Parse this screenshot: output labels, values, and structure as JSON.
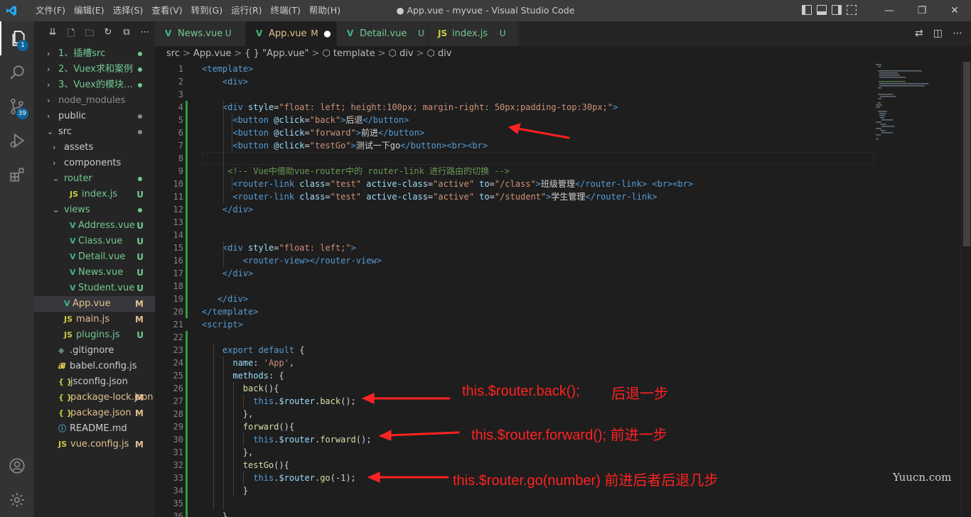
{
  "titlebar": {
    "menu": [
      "文件(F)",
      "编辑(E)",
      "选择(S)",
      "查看(V)",
      "转到(G)",
      "运行(R)",
      "终端(T)",
      "帮助(H)"
    ],
    "title": "● App.vue - myvue - Visual Studio Code",
    "controls": [
      "—",
      "❐",
      "✕"
    ]
  },
  "activity": {
    "explorer_badge": "1",
    "scm_badge": "39"
  },
  "sidebar": {
    "tools": [
      "⇊",
      "🗋",
      "🗀",
      "↻",
      "⧉",
      "⋯"
    ],
    "items": [
      {
        "name": "1、插槽src",
        "type": "folder",
        "indent": 0,
        "open": false,
        "status": "",
        "dot": "#73c991",
        "color": "#73c991"
      },
      {
        "name": "2、Vuex求和案例",
        "type": "folder",
        "indent": 0,
        "open": false,
        "status": "",
        "dot": "#73c991",
        "color": "#73c991"
      },
      {
        "name": "3、Vuex的模块…",
        "type": "folder",
        "indent": 0,
        "open": false,
        "status": "",
        "dot": "#73c991",
        "color": "#73c991"
      },
      {
        "name": "node_modules",
        "type": "folder",
        "indent": 0,
        "open": false,
        "status": "",
        "dot": "",
        "color": "#8c8c8c"
      },
      {
        "name": "public",
        "type": "folder",
        "indent": 0,
        "open": false,
        "status": "",
        "dot": "#8c8c8c",
        "color": "#cccccc"
      },
      {
        "name": "src",
        "type": "folder",
        "indent": 0,
        "open": true,
        "status": "",
        "dot": "#8c8c8c",
        "color": "#cccccc"
      },
      {
        "name": "assets",
        "type": "folder",
        "indent": 1,
        "open": false,
        "status": "",
        "dot": "",
        "color": "#cccccc"
      },
      {
        "name": "components",
        "type": "folder",
        "indent": 1,
        "open": false,
        "status": "",
        "dot": "",
        "color": "#cccccc"
      },
      {
        "name": "router",
        "type": "folder",
        "indent": 1,
        "open": true,
        "status": "",
        "dot": "#73c991",
        "color": "#73c991"
      },
      {
        "name": "index.js",
        "type": "js",
        "indent": 2,
        "status": "U",
        "dot": "",
        "color": "#73c991"
      },
      {
        "name": "views",
        "type": "folder",
        "indent": 1,
        "open": true,
        "status": "",
        "dot": "#73c991",
        "color": "#73c991"
      },
      {
        "name": "Address.vue",
        "type": "vue",
        "indent": 2,
        "status": "U",
        "dot": "",
        "color": "#73c991"
      },
      {
        "name": "Class.vue",
        "type": "vue",
        "indent": 2,
        "status": "U",
        "dot": "",
        "color": "#73c991"
      },
      {
        "name": "Detail.vue",
        "type": "vue",
        "indent": 2,
        "status": "U",
        "dot": "",
        "color": "#73c991"
      },
      {
        "name": "News.vue",
        "type": "vue",
        "indent": 2,
        "status": "U",
        "dot": "",
        "color": "#73c991"
      },
      {
        "name": "Student.vue",
        "type": "vue",
        "indent": 2,
        "status": "U",
        "dot": "",
        "color": "#73c991"
      },
      {
        "name": "App.vue",
        "type": "vue",
        "indent": 1,
        "status": "M",
        "dot": "",
        "color": "#e2c08d",
        "selected": true
      },
      {
        "name": "main.js",
        "type": "js",
        "indent": 1,
        "status": "M",
        "dot": "",
        "color": "#e2c08d"
      },
      {
        "name": "plugins.js",
        "type": "js",
        "indent": 1,
        "status": "U",
        "dot": "",
        "color": "#73c991"
      },
      {
        "name": ".gitignore",
        "type": "git",
        "indent": 0,
        "status": "",
        "dot": "",
        "color": "#cccccc"
      },
      {
        "name": "babel.config.js",
        "type": "babel",
        "indent": 0,
        "status": "",
        "dot": "",
        "color": "#cccccc"
      },
      {
        "name": "jsconfig.json",
        "type": "json",
        "indent": 0,
        "status": "",
        "dot": "",
        "color": "#cccccc"
      },
      {
        "name": "package-lock.json",
        "type": "json",
        "indent": 0,
        "status": "M",
        "dot": "",
        "color": "#e2c08d"
      },
      {
        "name": "package.json",
        "type": "json",
        "indent": 0,
        "status": "M",
        "dot": "",
        "color": "#e2c08d"
      },
      {
        "name": "README.md",
        "type": "info",
        "indent": 0,
        "status": "",
        "dot": "",
        "color": "#cccccc"
      },
      {
        "name": "vue.config.js",
        "type": "js",
        "indent": 0,
        "status": "M",
        "dot": "",
        "color": "#e2c08d"
      }
    ]
  },
  "tabs": [
    {
      "label": "News.vue",
      "status": "U",
      "icon": "V",
      "icon_color": "#41b883",
      "label_color": "#73c991",
      "active": false
    },
    {
      "label": "App.vue",
      "status": "M",
      "icon": "V",
      "icon_color": "#41b883",
      "label_color": "#e2c08d",
      "active": true,
      "dirty": "●"
    },
    {
      "label": "Detail.vue",
      "status": "U",
      "icon": "V",
      "icon_color": "#41b883",
      "label_color": "#73c991",
      "active": false
    },
    {
      "label": "index.js",
      "status": "U",
      "icon": "JS",
      "icon_color": "#cbcb41",
      "label_color": "#73c991",
      "active": false
    }
  ],
  "breadcrumb": [
    "src",
    ">",
    "App.vue",
    ">",
    "{ } \"App.vue\"",
    ">",
    "⬡ template",
    ">",
    "⬡ div",
    ">",
    "⬡ div"
  ],
  "code_lines": [
    [
      [
        "tg",
        "<template>"
      ]
    ],
    [
      [
        "tx",
        "    "
      ],
      [
        "tg",
        "<div>"
      ]
    ],
    [],
    [
      [
        "tx",
        "    "
      ],
      [
        "tg",
        "<div "
      ],
      [
        "at",
        "style"
      ],
      [
        "tx",
        "="
      ],
      [
        "sv",
        "\"float: left; height:100px; margin-right: 50px;padding-top:30px;\""
      ],
      [
        "tg",
        ">"
      ]
    ],
    [
      [
        "tx",
        "      "
      ],
      [
        "tg",
        "<button "
      ],
      [
        "at",
        "@click"
      ],
      [
        "tx",
        "="
      ],
      [
        "sv",
        "\"back\""
      ],
      [
        "tg",
        ">"
      ],
      [
        "tx",
        "后退"
      ],
      [
        "tg",
        "</button>"
      ]
    ],
    [
      [
        "tx",
        "      "
      ],
      [
        "tg",
        "<button "
      ],
      [
        "at",
        "@click"
      ],
      [
        "tx",
        "="
      ],
      [
        "sv",
        "\"forward\""
      ],
      [
        "tg",
        ">"
      ],
      [
        "tx",
        "前进"
      ],
      [
        "tg",
        "</button>"
      ]
    ],
    [
      [
        "tx",
        "      "
      ],
      [
        "tg",
        "<button "
      ],
      [
        "at",
        "@click"
      ],
      [
        "tx",
        "="
      ],
      [
        "sv",
        "\"testGo\""
      ],
      [
        "tg",
        ">"
      ],
      [
        "tx",
        "测试一下go"
      ],
      [
        "tg",
        "</button><br><br>"
      ]
    ],
    [],
    [
      [
        "tx",
        "     "
      ],
      [
        "cm",
        "<!-- Vue中借助vue-router中的 router-link 进行路由的切换 -->"
      ]
    ],
    [
      [
        "tx",
        "      "
      ],
      [
        "tg",
        "<router-link "
      ],
      [
        "at",
        "class"
      ],
      [
        "tx",
        "="
      ],
      [
        "sv",
        "\"test\""
      ],
      [
        "at",
        " active-class"
      ],
      [
        "tx",
        "="
      ],
      [
        "sv",
        "\"active\""
      ],
      [
        "at",
        " to"
      ],
      [
        "tx",
        "="
      ],
      [
        "sv",
        "\"/class\""
      ],
      [
        "tg",
        ">"
      ],
      [
        "tx",
        "班级管理"
      ],
      [
        "tg",
        "</router-link> <br><br>"
      ]
    ],
    [
      [
        "tx",
        "      "
      ],
      [
        "tg",
        "<router-link "
      ],
      [
        "at",
        "class"
      ],
      [
        "tx",
        "="
      ],
      [
        "sv",
        "\"test\""
      ],
      [
        "at",
        " active-class"
      ],
      [
        "tx",
        "="
      ],
      [
        "sv",
        "\"active\""
      ],
      [
        "at",
        " to"
      ],
      [
        "tx",
        "="
      ],
      [
        "sv",
        "\"/student\""
      ],
      [
        "tg",
        ">"
      ],
      [
        "tx",
        "学生管理"
      ],
      [
        "tg",
        "</router-link>"
      ]
    ],
    [
      [
        "tx",
        "    "
      ],
      [
        "tg",
        "</div>"
      ]
    ],
    [],
    [],
    [
      [
        "tx",
        "    "
      ],
      [
        "tg",
        "<div "
      ],
      [
        "at",
        "style"
      ],
      [
        "tx",
        "="
      ],
      [
        "sv",
        "\"float: left;\""
      ],
      [
        "tg",
        ">"
      ]
    ],
    [
      [
        "tx",
        "        "
      ],
      [
        "tg",
        "<router-view></router-view>"
      ]
    ],
    [
      [
        "tx",
        "    "
      ],
      [
        "tg",
        "</div>"
      ]
    ],
    [],
    [
      [
        "tx",
        "   "
      ],
      [
        "tg",
        "</div>"
      ]
    ],
    [
      [
        "tg",
        "</template>"
      ]
    ],
    [
      [
        "tg",
        "<script>"
      ]
    ],
    [],
    [
      [
        "tx",
        "    "
      ],
      [
        "kw",
        "export default"
      ],
      [
        "tx",
        " {"
      ]
    ],
    [
      [
        "tx",
        "      "
      ],
      [
        "pr",
        "name"
      ],
      [
        "tx",
        ": "
      ],
      [
        "sv",
        "'App'"
      ],
      [
        "tx",
        ","
      ]
    ],
    [
      [
        "tx",
        "      "
      ],
      [
        "pr",
        "methods"
      ],
      [
        "tx",
        ": {"
      ]
    ],
    [
      [
        "tx",
        "        "
      ],
      [
        "fn",
        "back"
      ],
      [
        "tx",
        "(){"
      ]
    ],
    [
      [
        "tx",
        "          "
      ],
      [
        "kw",
        "this"
      ],
      [
        "tx",
        "."
      ],
      [
        "pr",
        "$router"
      ],
      [
        "tx",
        "."
      ],
      [
        "fn",
        "back"
      ],
      [
        "tx",
        "();"
      ]
    ],
    [
      [
        "tx",
        "        },"
      ]
    ],
    [
      [
        "tx",
        "        "
      ],
      [
        "fn",
        "forward"
      ],
      [
        "tx",
        "(){"
      ]
    ],
    [
      [
        "tx",
        "          "
      ],
      [
        "kw",
        "this"
      ],
      [
        "tx",
        "."
      ],
      [
        "pr",
        "$router"
      ],
      [
        "tx",
        "."
      ],
      [
        "fn",
        "forward"
      ],
      [
        "tx",
        "();"
      ]
    ],
    [
      [
        "tx",
        "        },"
      ]
    ],
    [
      [
        "tx",
        "        "
      ],
      [
        "fn",
        "testGo"
      ],
      [
        "tx",
        "(){"
      ]
    ],
    [
      [
        "tx",
        "          "
      ],
      [
        "kw",
        "this"
      ],
      [
        "tx",
        "."
      ],
      [
        "pr",
        "$router"
      ],
      [
        "tx",
        "."
      ],
      [
        "fn",
        "go"
      ],
      [
        "tx",
        "(-1);"
      ]
    ],
    [
      [
        "tx",
        "        }"
      ]
    ],
    [],
    [
      [
        "tx",
        "    }"
      ]
    ]
  ],
  "annotations": [
    {
      "text": "this.$router.back();",
      "arrow_to_line": 27
    },
    {
      "text": "后退一步"
    },
    {
      "text": "this.$router.forward(); 前进一步",
      "arrow_to_line": 30
    },
    {
      "text": "this.$router.go(number) 前进后者后退几步",
      "arrow_to_line": 33
    }
  ],
  "watermark": "Yuucn.com",
  "colors": {
    "accent": "#007acc",
    "annotation": "#ff2222",
    "vue": "#41b883",
    "js": "#cbcb41"
  }
}
